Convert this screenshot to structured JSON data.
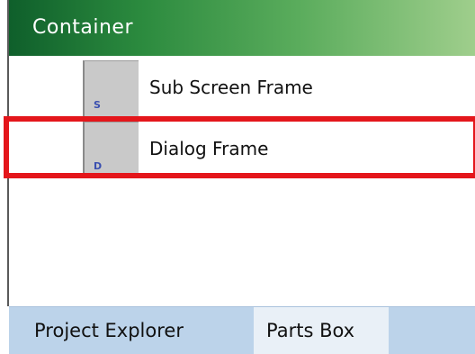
{
  "panel": {
    "header_title": "Container",
    "items": [
      {
        "label": "Sub Screen Frame",
        "icon_letter": "S",
        "icon": "sub-screen-frame-icon"
      },
      {
        "label": "Dialog Frame",
        "icon_letter": "D",
        "icon": "dialog-frame-icon"
      }
    ],
    "highlight_color": "#e4161b"
  },
  "tabs": [
    {
      "label": "Project Explorer",
      "active": false
    },
    {
      "label": "Parts Box",
      "active": true
    }
  ]
}
